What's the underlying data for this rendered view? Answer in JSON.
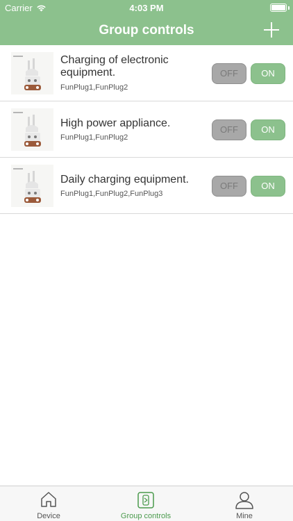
{
  "status_bar": {
    "carrier": "Carrier",
    "time": "4:03 PM",
    "wifi_icon": "wifi-icon",
    "battery_icon": "battery-icon"
  },
  "header": {
    "title": "Group controls",
    "add_icon": "plus-icon"
  },
  "groups": [
    {
      "name": "Charging of electronic equipment.",
      "devices": "FunPlug1,FunPlug2",
      "off_label": "OFF",
      "on_label": "ON"
    },
    {
      "name": "High power appliance.",
      "devices": "FunPlug1,FunPlug2",
      "off_label": "OFF",
      "on_label": "ON"
    },
    {
      "name": "Daily charging equipment.",
      "devices": "FunPlug1,FunPlug2,FunPlug3",
      "off_label": "OFF",
      "on_label": "ON"
    }
  ],
  "tab_bar": {
    "tabs": [
      {
        "label": "Device",
        "icon": "home-icon",
        "active": false
      },
      {
        "label": "Group controls",
        "icon": "group-controls-icon",
        "active": true
      },
      {
        "label": "Mine",
        "icon": "person-icon",
        "active": false
      }
    ]
  },
  "colors": {
    "accent": "#8cc18d",
    "active_tab": "#4a9a4c",
    "off_button": "#a8a8a8"
  }
}
